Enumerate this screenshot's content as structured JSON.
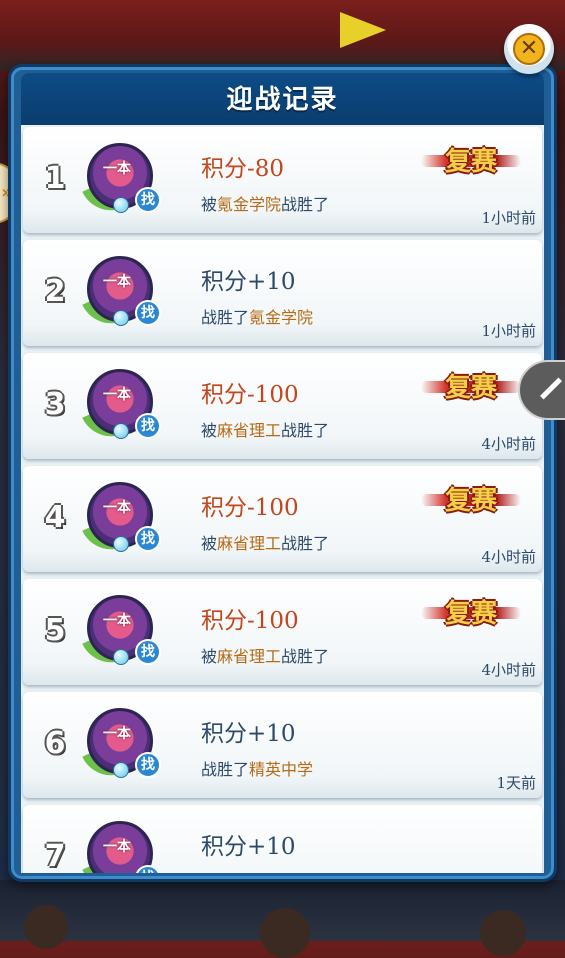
{
  "dialog": {
    "title": "迎战记录"
  },
  "records": [
    {
      "rank": "1",
      "avatar_text": "一本",
      "badge": "找",
      "score": "积分-80",
      "outcome": "loss",
      "desc_prefix": "被",
      "school": "氪金学院",
      "desc_suffix": "战胜了",
      "time": "1小时前",
      "rematch": "复赛"
    },
    {
      "rank": "2",
      "avatar_text": "一本",
      "badge": "找",
      "score": "积分+10",
      "outcome": "win",
      "desc_prefix": "战胜了",
      "school": "氪金学院",
      "desc_suffix": "",
      "time": "1小时前",
      "rematch": ""
    },
    {
      "rank": "3",
      "avatar_text": "一本",
      "badge": "找",
      "score": "积分-100",
      "outcome": "loss",
      "desc_prefix": "被",
      "school": "麻省理工",
      "desc_suffix": "战胜了",
      "time": "4小时前",
      "rematch": "复赛"
    },
    {
      "rank": "4",
      "avatar_text": "一本",
      "badge": "找",
      "score": "积分-100",
      "outcome": "loss",
      "desc_prefix": "被",
      "school": "麻省理工",
      "desc_suffix": "战胜了",
      "time": "4小时前",
      "rematch": "复赛"
    },
    {
      "rank": "5",
      "avatar_text": "一本",
      "badge": "找",
      "score": "积分-100",
      "outcome": "loss",
      "desc_prefix": "被",
      "school": "麻省理工",
      "desc_suffix": "战胜了",
      "time": "4小时前",
      "rematch": "复赛"
    },
    {
      "rank": "6",
      "avatar_text": "一本",
      "badge": "找",
      "score": "积分+10",
      "outcome": "win",
      "desc_prefix": "战胜了",
      "school": "精英中学",
      "desc_suffix": "",
      "time": "1天前",
      "rematch": ""
    },
    {
      "rank": "7",
      "avatar_text": "一本",
      "badge": "找",
      "score": "积分+10",
      "outcome": "win",
      "desc_prefix": "",
      "school": "",
      "desc_suffix": "",
      "time": "",
      "rematch": ""
    }
  ],
  "controls": {
    "close_icon": "close-icon",
    "side_tab_label": "»",
    "edit_icon": "pencil-icon"
  },
  "colors": {
    "panel_blue": "#1f5f96",
    "header_blue": "#0d4c86",
    "loss_text": "#c4461c",
    "school_text": "#b86a14",
    "normal_text": "#2e4a6a",
    "rematch_gold": "#f3d048"
  }
}
